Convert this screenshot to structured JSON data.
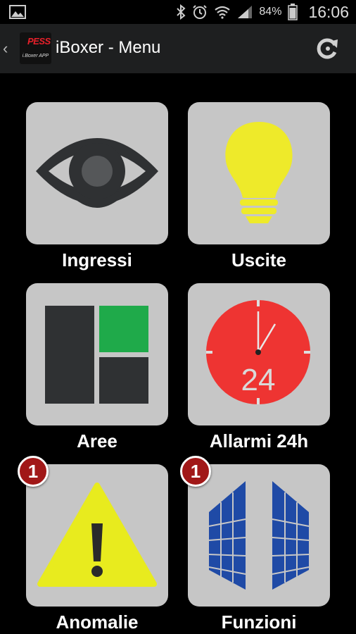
{
  "status_bar": {
    "battery_percent": "84%",
    "time": "16:06",
    "icons": [
      "gallery-icon",
      "bluetooth-icon",
      "alarm-clock-icon",
      "wifi-icon",
      "signal-icon",
      "battery-icon"
    ]
  },
  "action_bar": {
    "title": "iBoxer - Menu",
    "logo_brand": "PESS",
    "logo_sub": "i.Boxer APP",
    "refresh_icon": "refresh-icon"
  },
  "menu": [
    {
      "label": "Ingressi",
      "icon": "eye-icon",
      "badge": null
    },
    {
      "label": "Uscite",
      "icon": "lightbulb-icon",
      "badge": null
    },
    {
      "label": "Aree",
      "icon": "areas-icon",
      "badge": null
    },
    {
      "label": "Allarmi 24h",
      "icon": "clock-24h-icon",
      "badge": null,
      "icon_text": "24"
    },
    {
      "label": "Anomalie",
      "icon": "warning-icon",
      "badge": "1"
    },
    {
      "label": "Funzioni",
      "icon": "gate-icon",
      "badge": "1"
    }
  ],
  "colors": {
    "tile_bg": "#c6c6c6",
    "action_bar": "#1e1f20",
    "badge": "#a11818",
    "lightbulb": "#eeea2a",
    "area_active": "#1faa4a",
    "clock": "#ee3432",
    "warning": "#e8eb1e",
    "gate": "#1f4aa6"
  }
}
